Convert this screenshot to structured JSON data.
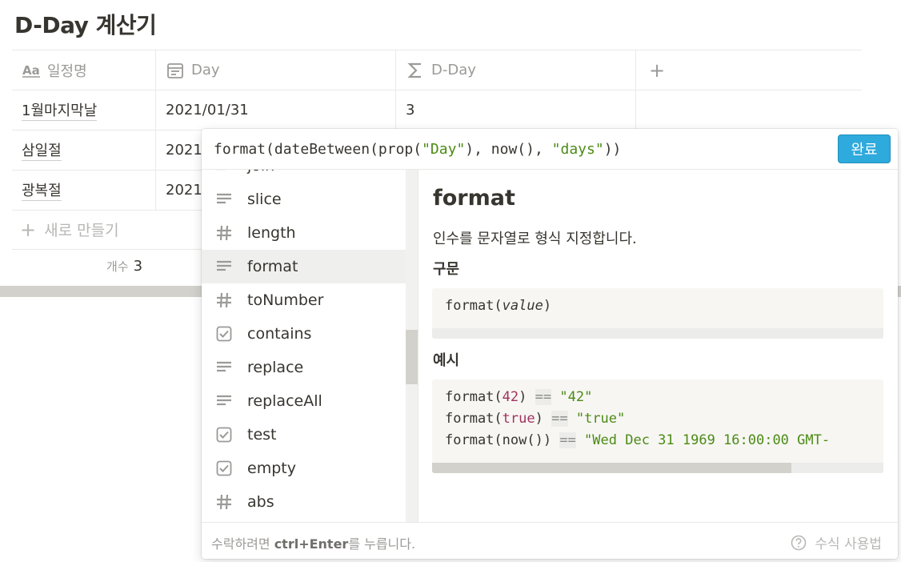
{
  "page": {
    "title": "D-Day 계산기"
  },
  "table": {
    "columns": [
      {
        "label": "일정명",
        "icon": "text-aa-icon"
      },
      {
        "label": "Day",
        "icon": "calendar-icon"
      },
      {
        "label": "D-Day",
        "icon": "sigma-icon"
      }
    ],
    "add_column_label": "+",
    "rows": [
      {
        "name": "1월마지막날",
        "day": "2021/01/31",
        "dday": "3"
      },
      {
        "name": "삼일절",
        "day": "2021",
        "dday": ""
      },
      {
        "name": "광복절",
        "day": "2021",
        "dday": ""
      }
    ],
    "new_row_label": "새로 만들기",
    "count_label": "개수",
    "count_value": "3"
  },
  "formula": {
    "parts": {
      "p1": "format(dateBetween(prop(",
      "s1": "\"Day\"",
      "p2": "), now(), ",
      "s2": "\"days\"",
      "p3": "))"
    },
    "done_label": "완료"
  },
  "functions": {
    "partial_top": "join",
    "items": [
      {
        "label": "slice",
        "icon": "text-lines-icon"
      },
      {
        "label": "length",
        "icon": "hash-icon"
      },
      {
        "label": "format",
        "icon": "text-lines-icon",
        "selected": true
      },
      {
        "label": "toNumber",
        "icon": "hash-icon"
      },
      {
        "label": "contains",
        "icon": "checkbox-icon"
      },
      {
        "label": "replace",
        "icon": "text-lines-icon"
      },
      {
        "label": "replaceAll",
        "icon": "text-lines-icon"
      },
      {
        "label": "test",
        "icon": "checkbox-icon"
      },
      {
        "label": "empty",
        "icon": "checkbox-icon"
      },
      {
        "label": "abs",
        "icon": "hash-icon"
      }
    ]
  },
  "doc": {
    "title": "format",
    "description": "인수를 문자열로 형식 지정합니다.",
    "syntax_heading": "구문",
    "syntax": {
      "fn": "format(",
      "arg": "value",
      "close": ")"
    },
    "examples_heading": "예시",
    "examples": [
      {
        "pre": "format(",
        "arg": "42",
        "post": ")",
        "op": "==",
        "result": "\"42\""
      },
      {
        "pre": "format(",
        "arg": "true",
        "post": ")",
        "op": "==",
        "result": "\"true\""
      },
      {
        "pre": "format(now())",
        "arg": "",
        "post": "",
        "op": "==",
        "result": "\"Wed Dec 31 1969 16:00:00 GMT-"
      }
    ]
  },
  "footer": {
    "hint_pre": "수락하려면 ",
    "hint_key": "ctrl+Enter",
    "hint_post": "를 누릅니다.",
    "help_label": "수식 사용법"
  },
  "colors": {
    "accent": "#2eaadc",
    "string": "#4c8b16",
    "number": "#a0335f"
  }
}
